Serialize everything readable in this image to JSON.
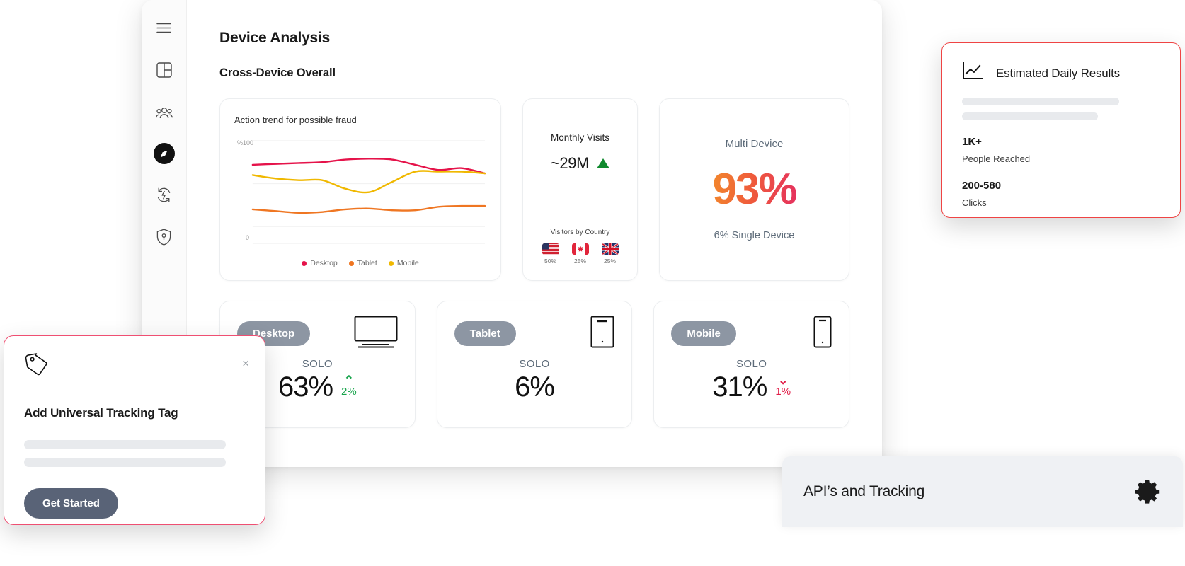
{
  "sidebar": {
    "items": [
      {
        "name": "menu-icon",
        "label": "Menu"
      },
      {
        "name": "dashboard-icon",
        "label": "Dashboard"
      },
      {
        "name": "people-icon",
        "label": "Audiences"
      },
      {
        "name": "compass-icon",
        "label": "Explore",
        "active": true
      },
      {
        "name": "refresh-bolt-icon",
        "label": "Automation"
      },
      {
        "name": "shield-lock-icon",
        "label": "Security"
      }
    ]
  },
  "header": {
    "page_title": "Device Analysis",
    "section_title": "Cross-Device Overall"
  },
  "fraud_card": {
    "title": "Action trend for possible fraud",
    "axis_top": "%100",
    "axis_bottom": "0"
  },
  "visits_card": {
    "label": "Monthly Visits",
    "value": "~29M",
    "trend_direction": "up",
    "trend_color": "#108a2e",
    "country_label": "Visitors by Country",
    "countries": [
      {
        "code": "US",
        "flag": "us-flag-icon",
        "pct": "50%"
      },
      {
        "code": "CA",
        "flag": "ca-flag-icon",
        "pct": "25%"
      },
      {
        "code": "UK",
        "flag": "uk-flag-icon",
        "pct": "25%"
      }
    ]
  },
  "multi_device_card": {
    "label": "Multi Device",
    "value": "93%",
    "sub": "6% Single Device",
    "gradient_from": "#f2882c",
    "gradient_to": "#e5315f"
  },
  "device_cards": [
    {
      "pill": "Desktop",
      "icon": "desktop-monitor-icon",
      "solo_label": "SOLO",
      "value": "63%",
      "delta": "2%",
      "delta_dir": "up",
      "delta_color": "#16a34a"
    },
    {
      "pill": "Tablet",
      "icon": "tablet-icon",
      "solo_label": "SOLO",
      "value": "6%",
      "delta": "",
      "delta_dir": "none",
      "delta_color": ""
    },
    {
      "pill": "Mobile",
      "icon": "mobile-phone-icon",
      "solo_label": "SOLO",
      "value": "31%",
      "delta": "1%",
      "delta_dir": "down",
      "delta_color": "#e11d48"
    }
  ],
  "tracking_popup": {
    "icon": "price-tag-icon",
    "close": "×",
    "title": "Add Universal Tracking Tag",
    "button_label": "Get Started",
    "border_color": "#ef4f72"
  },
  "estimated_card": {
    "icon": "line-chart-icon",
    "title": "Estimated Daily Results",
    "stats": [
      {
        "number": "1K+",
        "label": "People Reached"
      },
      {
        "number": "200-580",
        "label": "Clicks"
      }
    ],
    "border_color": "#ef4444"
  },
  "api_bar": {
    "title": "API’s and Tracking",
    "icon": "gear-icon"
  },
  "chart_data": {
    "type": "line",
    "title": "Action trend for possible fraud",
    "xlabel": "",
    "ylabel": "%",
    "ylim": [
      0,
      100
    ],
    "yticks": [
      "0",
      "%100"
    ],
    "grid": true,
    "legend_position": "bottom",
    "x": [
      0,
      1,
      2,
      3,
      4,
      5,
      6,
      7,
      8,
      9,
      10
    ],
    "series": [
      {
        "name": "Desktop",
        "color": "#e5134a",
        "values": [
          72,
          73,
          74,
          75,
          78,
          79,
          78,
          72,
          66,
          68,
          62
        ]
      },
      {
        "name": "Tablet",
        "color": "#ef7622",
        "values": [
          20,
          18,
          16,
          17,
          20,
          21,
          19,
          19,
          23,
          24,
          24
        ]
      },
      {
        "name": "Mobile",
        "color": "#f0b800",
        "values": [
          60,
          56,
          54,
          54,
          44,
          40,
          52,
          64,
          64,
          64,
          62
        ]
      }
    ]
  }
}
